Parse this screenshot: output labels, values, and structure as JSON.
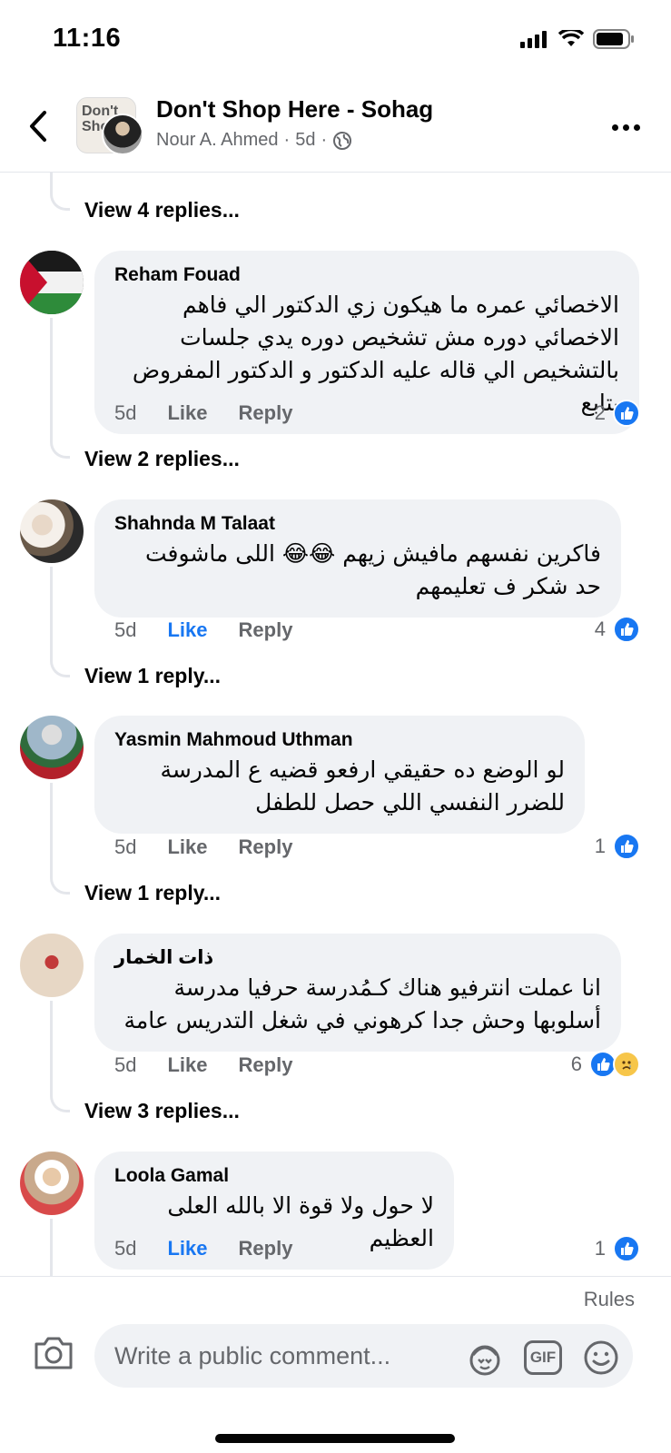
{
  "status_bar": {
    "time": "11:16"
  },
  "header": {
    "group_title": "Don't Shop Here - Sohag",
    "author": "Nour A. Ahmed",
    "age": "5d",
    "group_thumb_text": "Don't Shop"
  },
  "partial_top": {
    "view_replies": "View 4 replies..."
  },
  "comments": [
    {
      "name": "Reham Fouad",
      "text": "الاخصائي عمره ما هيكون زي الدكتور الي فاهم الاخصائي دوره مش تشخيص دوره يدي جلسات بالتشخيص الي قاله عليه الدكتور و الدكتور المفروض يتابع",
      "time": "5d",
      "like": "Like",
      "reply": "Reply",
      "liked": false,
      "reaction_count": "2",
      "view_replies": "View 2 replies..."
    },
    {
      "name": "Shahnda M Talaat",
      "text": "فاكرين نفسهم مافيش زيهم 😂😂 اللى ماشوفت حد شكر ف تعليمهم",
      "time": "5d",
      "like": "Like",
      "reply": "Reply",
      "liked": true,
      "reaction_count": "4",
      "view_replies": "View 1 reply..."
    },
    {
      "name": "Yasmin Mahmoud Uthman",
      "text": "لو الوضع ده حقيقي ارفعو قضيه ع المدرسة للضرر النفسي اللي حصل للطفل",
      "time": "5d",
      "like": "Like",
      "reply": "Reply",
      "liked": false,
      "reaction_count": "1",
      "view_replies": "View 1 reply..."
    },
    {
      "name": "ذات الخمار",
      "text": "انا عملت انترفيو هناك كـمُدرسة حرفيا مدرسة أسلوبها وحش جدا كرهوني في شغل التدريس عامة",
      "time": "5d",
      "like": "Like",
      "reply": "Reply",
      "liked": false,
      "reaction_count": "6",
      "view_replies": "View 3 replies..."
    },
    {
      "name": "Loola Gamal",
      "text": "لا حول ولا قوة الا بالله العلى العظيم",
      "time": "5d",
      "like": "Like",
      "reply": "Reply",
      "liked": false,
      "reaction_count": "1"
    }
  ],
  "composer": {
    "rules": "Rules",
    "placeholder": "Write a public comment...",
    "gif_label": "GIF"
  },
  "colors": {
    "accent": "#1877f2",
    "bubble": "#f0f2f5",
    "muted": "#65676b"
  }
}
